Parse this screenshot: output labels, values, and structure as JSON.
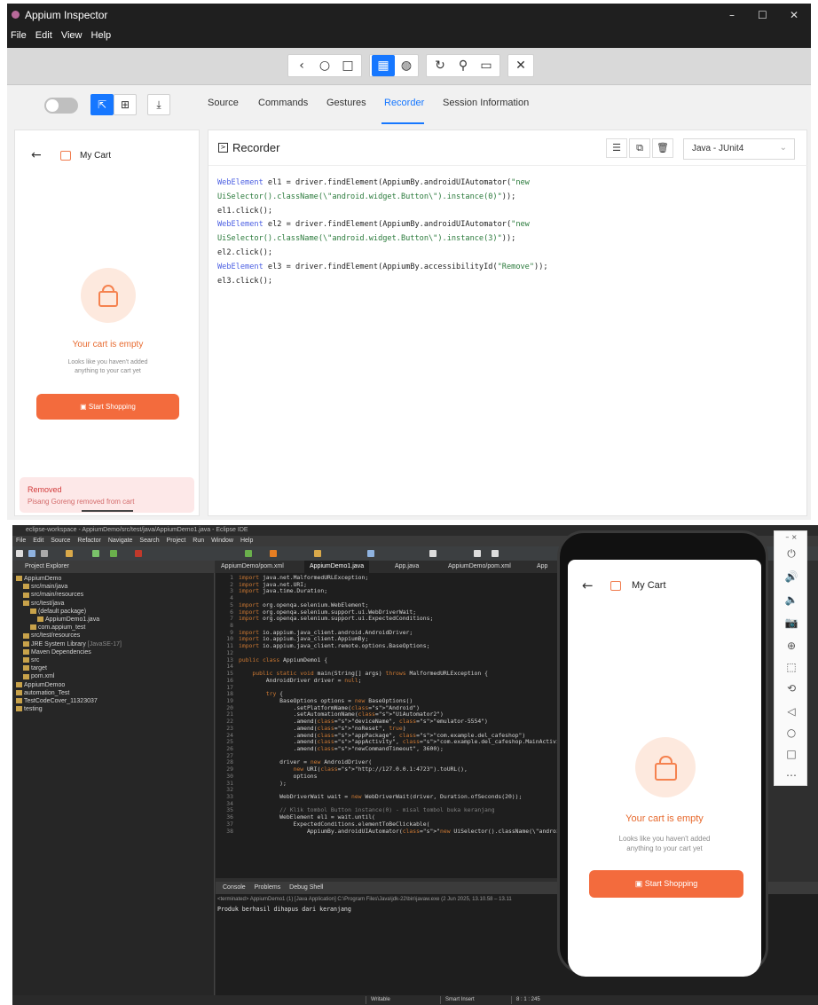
{
  "inspector": {
    "window_title": "Appium Inspector",
    "menu": [
      "File",
      "Edit",
      "View",
      "Help"
    ],
    "window_controls": [
      "–",
      "☐",
      "✕"
    ],
    "toolbar_icons": [
      "‹",
      "○",
      "□",
      "▦",
      "◍",
      "↻",
      "⚲",
      "▭",
      "✕"
    ],
    "tabs": [
      "Source",
      "Commands",
      "Gestures",
      "Recorder",
      "Session Information"
    ],
    "active_tab": "Recorder",
    "recorder": {
      "title": "Recorder",
      "language": "Java - JUnit4",
      "code_lines": [
        [
          "kw",
          "WebElement",
          "plain",
          " el1 = driver.findElement(AppiumBy.androidUIAutomator(",
          "str",
          "\"new"
        ],
        [
          "str",
          "UiSelector().className(\\\"android.widget.Button\\\").instance(0)\"",
          "plain",
          "));"
        ],
        [
          "plain",
          "el1.click();"
        ],
        [
          "kw",
          "WebElement",
          "plain",
          " el2 = driver.findElement(AppiumBy.androidUIAutomator(",
          "str",
          "\"new"
        ],
        [
          "str",
          "UiSelector().className(\\\"android.widget.Button\\\").instance(3)\"",
          "plain",
          "));"
        ],
        [
          "plain",
          "el2.click();"
        ],
        [
          "kw",
          "WebElement",
          "plain",
          " el3 = driver.findElement(AppiumBy.accessibilityId(",
          "str",
          "\"Remove\"",
          "plain",
          "));"
        ],
        [
          "plain",
          "el3.click();"
        ]
      ]
    }
  },
  "app": {
    "page_title": "My Cart",
    "empty_title": "Your cart is empty",
    "empty_sub_line1": "Looks like you haven't added",
    "empty_sub_line2": "anything to your cart yet",
    "shop_button": "Start Shopping",
    "toast_title": "Removed",
    "toast_message": "Pisang Goreng removed from cart",
    "accent_color": "#f36b3d"
  },
  "eclipse": {
    "window_title": "eclipse-workspace - AppiumDemo/src/test/java/AppiumDemo1.java - Eclipse IDE",
    "menu": [
      "File",
      "Edit",
      "Source",
      "Refactor",
      "Navigate",
      "Search",
      "Project",
      "Run",
      "Window",
      "Help"
    ],
    "explorer_title": "Project Explorer",
    "tree": [
      {
        "depth": 0,
        "label": "AppiumDemo"
      },
      {
        "depth": 1,
        "label": "src/main/java"
      },
      {
        "depth": 1,
        "label": "src/main/resources"
      },
      {
        "depth": 1,
        "label": "src/test/java"
      },
      {
        "depth": 2,
        "label": "(default package)"
      },
      {
        "depth": 3,
        "label": "AppiumDemo1.java"
      },
      {
        "depth": 2,
        "label": "com.appium_test"
      },
      {
        "depth": 1,
        "label": "src/test/resources"
      },
      {
        "depth": 1,
        "label": "JRE System Library",
        "extra": "[JavaSE-17]"
      },
      {
        "depth": 1,
        "label": "Maven Dependencies"
      },
      {
        "depth": 1,
        "label": "src"
      },
      {
        "depth": 1,
        "label": "target"
      },
      {
        "depth": 1,
        "label": "pom.xml"
      },
      {
        "depth": 0,
        "label": "AppiumDemoo"
      },
      {
        "depth": 0,
        "label": "automation_Test"
      },
      {
        "depth": 0,
        "label": "TestCodeCover_11323037"
      },
      {
        "depth": 0,
        "label": "testing"
      }
    ],
    "editor_tabs": [
      "AppiumDemo/pom.xml",
      "AppiumDemo1.java",
      "App.java",
      "AppiumDemo/pom.xml",
      "App"
    ],
    "active_editor_tab": "AppiumDemo1.java",
    "code": [
      "import java.net.MalformedURLException;",
      "import java.net.URI;",
      "import java.time.Duration;",
      "",
      "import org.openqa.selenium.WebElement;",
      "import org.openqa.selenium.support.ui.WebDriverWait;",
      "import org.openqa.selenium.support.ui.ExpectedConditions;",
      "",
      "import io.appium.java_client.android.AndroidDriver;",
      "import io.appium.java_client.AppiumBy;",
      "import io.appium.java_client.remote.options.BaseOptions;",
      "",
      "public class AppiumDemo1 {",
      "",
      "    public static void main(String[] args) throws MalformedURLException {",
      "        AndroidDriver driver = null;",
      "",
      "        try {",
      "            BaseOptions options = new BaseOptions()",
      "                .setPlatformName(\"Android\")",
      "                .setAutomationName(\"UiAutomator2\")",
      "                .amend(\"deviceName\", \"emulator-5554\")",
      "                .amend(\"noReset\", true)",
      "                .amend(\"appPackage\", \"com.example.del_cafeshop\")",
      "                .amend(\"appActivity\", \"com.example.del_cafeshop.MainActivity\")",
      "                .amend(\"newCommandTimeout\", 3600);",
      "",
      "            driver = new AndroidDriver(",
      "                new URI(\"http://127.0.0.1:4723\").toURL(),",
      "                options",
      "            );",
      "",
      "            WebDriverWait wait = new WebDriverWait(driver, Duration.ofSeconds(20));",
      "",
      "            // Klik tombol Button instance(0) - misal tombol buka keranjang",
      "            WebElement el1 = wait.until(",
      "                ExpectedConditions.elementToBeClickable(",
      "                    AppiumBy.androidUIAutomator(\"new UiSelector().className(\\\"android.w"
    ],
    "console_tabs": [
      "Console",
      "Problems",
      "Debug Shell"
    ],
    "console_terminated": "<terminated> AppiumDemo1 (1) [Java Application] C:\\Program Files\\Java\\jdk-22\\bin\\javaw.exe (2 Jun 2025, 13.10.58 – 13.11",
    "console_output": "Produk berhasil dihapus dari keranjang",
    "status": {
      "writable": "Writable",
      "insert": "Smart Insert",
      "position": "8 : 1 : 245"
    }
  },
  "emulator_side_icons": [
    "⏻",
    "🔊",
    "🔈",
    "📷",
    "⊕",
    "⬚",
    "⟲",
    "◁",
    "○",
    "□",
    "⋯"
  ]
}
